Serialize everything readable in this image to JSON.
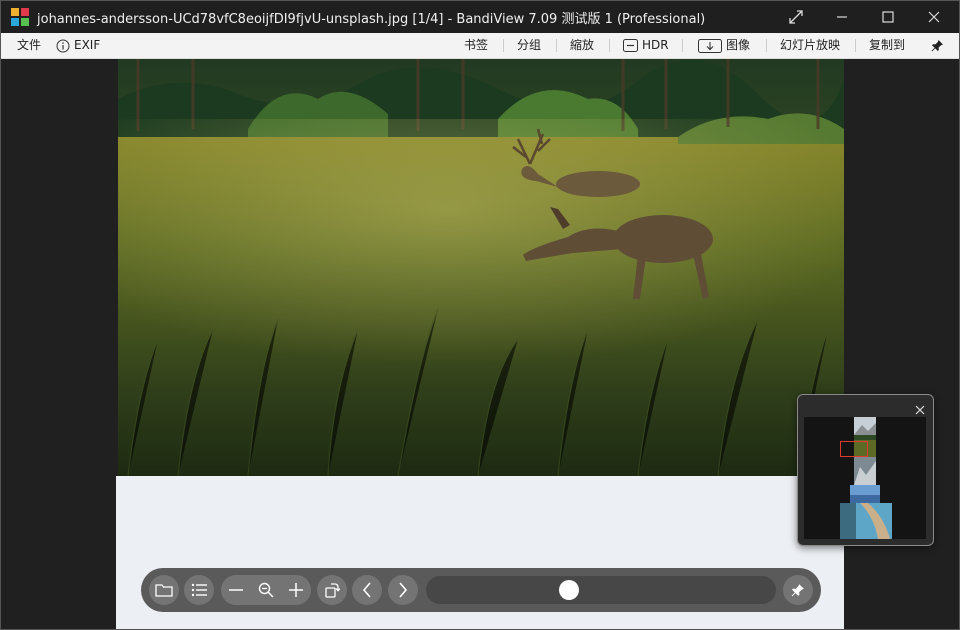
{
  "window": {
    "title": "johannes-andersson-UCd78vfC8eoijfDI9fjvU-unsplash.jpg [1/4] - BandiView 7.09 测试版 1 (Professional)"
  },
  "menubar": {
    "file": "文件",
    "exif": "EXIF",
    "bookmark": "书签",
    "split": "分组",
    "zoom": "縮放",
    "hdr": "HDR",
    "image": "图像",
    "slideshow": "幻灯片放映",
    "copy_to": "复制到"
  },
  "viewer": {
    "slider_level": 0.4
  },
  "colors": {
    "accent_marker": "#e03a2f"
  }
}
